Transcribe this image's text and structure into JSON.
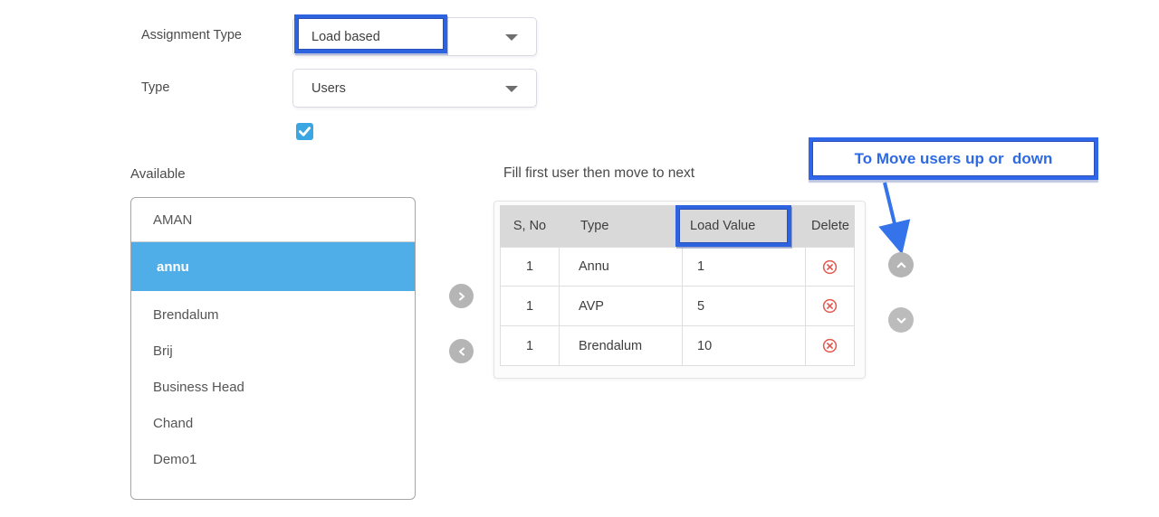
{
  "form": {
    "assignment_type": {
      "label": "Assignment Type",
      "value": "Load based"
    },
    "type": {
      "label": "Type",
      "value": "Users"
    },
    "users_checkbox": {
      "checked": true
    }
  },
  "available_panel": {
    "label": "Available",
    "items": [
      {
        "label": "AMAN",
        "selected": false
      },
      {
        "label": "annu",
        "selected": true
      },
      {
        "label": "Brendalum",
        "selected": false
      },
      {
        "label": "Brij",
        "selected": false
      },
      {
        "label": "Business Head",
        "selected": false
      },
      {
        "label": "Chand",
        "selected": false
      },
      {
        "label": "Demo1",
        "selected": false
      }
    ]
  },
  "assigned_panel": {
    "title": "Fill first user then move to next",
    "columns": [
      "S, No",
      "Type",
      "Load Value",
      "Delete"
    ],
    "rows": [
      {
        "sno": "1",
        "type": "Annu",
        "load_value": "1"
      },
      {
        "sno": "1",
        "type": "AVP",
        "load_value": "5"
      },
      {
        "sno": "1",
        "type": "Brendalum",
        "load_value": "10"
      }
    ]
  },
  "annotations": {
    "tooltip_text": "To Move users up or  down",
    "highlighted_values": [
      "Load based",
      "Load Value"
    ]
  },
  "icons": {
    "dropdown_caret": "chevron-down",
    "move_right": "chevron-right",
    "move_left": "chevron-left",
    "move_up": "chevron-up",
    "move_down": "chevron-down",
    "delete": "circled-x",
    "checkbox_check": "checkmark"
  },
  "colors": {
    "annotation_blue": "#2e63e0",
    "selection_blue": "#4fade8",
    "checkbox_blue": "#3ba7e2",
    "delete_red": "#e25950",
    "circle_button_gray": "#b5b5b5",
    "table_header_gray": "#d9d9d9"
  }
}
